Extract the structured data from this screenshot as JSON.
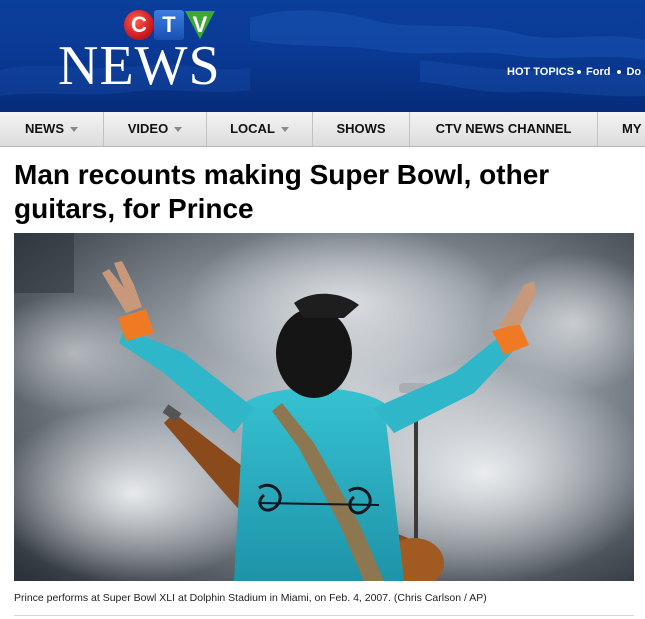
{
  "header": {
    "logo_letters": [
      "C",
      "T",
      "V"
    ],
    "logo_word": "NEWS",
    "hot_topics_label": "HOT TOPICS",
    "hot_topics": [
      "Ford",
      "Do"
    ]
  },
  "nav": {
    "items": [
      {
        "label": "NEWS",
        "has_dropdown": true
      },
      {
        "label": "VIDEO",
        "has_dropdown": true
      },
      {
        "label": "LOCAL",
        "has_dropdown": true
      },
      {
        "label": "SHOWS",
        "has_dropdown": false
      },
      {
        "label": "CTV NEWS CHANNEL",
        "has_dropdown": false
      },
      {
        "label": "MY",
        "has_dropdown": false
      }
    ]
  },
  "article": {
    "headline": "Man recounts making Super Bowl, other guitars, for Prince",
    "photo_caption": "Prince performs at Super Bowl XLI at Dolphin Stadium in Miami, on Feb. 4, 2007. (Chris Carlson / AP)"
  },
  "colors": {
    "header_blue": "#0a3a95",
    "logo_red": "#c4141a",
    "logo_blue": "#1c4fb3",
    "logo_green": "#3fa535",
    "costume_turquoise": "#2ab3c6",
    "cuff_orange": "#f07a23"
  }
}
